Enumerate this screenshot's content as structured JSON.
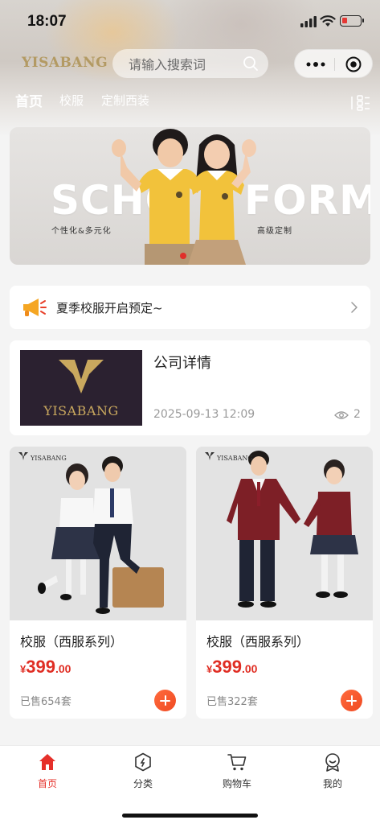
{
  "status_bar": {
    "time": "18:07"
  },
  "header": {
    "brand": "YISABANG",
    "search_placeholder": "请输入搜索词"
  },
  "tabs": [
    "首页",
    "校服",
    "定制西装"
  ],
  "banner": {
    "word_left": "SCHO",
    "word_right": "FORM",
    "sub_left": "个性化&多元化",
    "sub_right": "高级定制"
  },
  "notice": {
    "text": "夏季校服开启预定~"
  },
  "article": {
    "thumb_text": "YISABANG",
    "title": "公司详情",
    "date": "2025-09-13 12:09",
    "views": "2"
  },
  "products": [
    {
      "brand": "YISABANG",
      "title": "校服（西服系列）",
      "currency": "¥",
      "price_int": "399",
      "price_dec": ".00",
      "sold": "已售654套"
    },
    {
      "brand": "YISABANG",
      "title": "校服（西服系列）",
      "currency": "¥",
      "price_int": "399",
      "price_dec": ".00",
      "sold": "已售322套"
    }
  ],
  "tabbar": {
    "items": [
      {
        "label": "首页",
        "icon": "home-icon"
      },
      {
        "label": "分类",
        "icon": "category-icon"
      },
      {
        "label": "购物车",
        "icon": "cart-icon"
      },
      {
        "label": "我的",
        "icon": "profile-icon"
      }
    ]
  },
  "colors": {
    "accent": "#e5302a",
    "brand_gold": "#b39a63",
    "price": "#e02e24"
  }
}
